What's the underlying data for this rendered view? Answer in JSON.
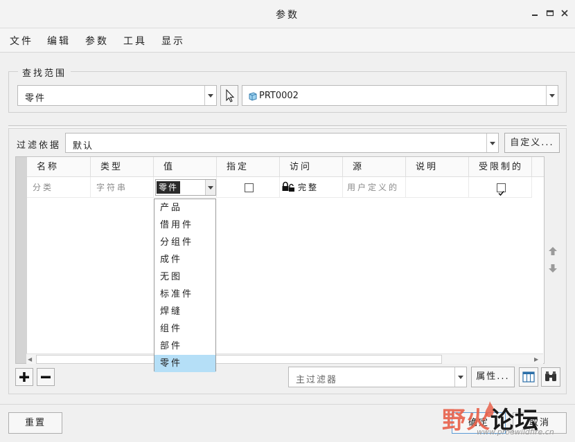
{
  "window": {
    "title": "参数"
  },
  "menubar": {
    "items": [
      "文件",
      "编辑",
      "参数",
      "工具",
      "显示"
    ]
  },
  "scope": {
    "legend": "查找范围",
    "type_value": "零件",
    "model_value": "PRT0002"
  },
  "filter": {
    "label": "过滤依据",
    "value": "默认",
    "customize_label": "自定义..."
  },
  "table": {
    "columns": [
      "名称",
      "类型",
      "值",
      "指定",
      "访问",
      "源",
      "说明",
      "受限制的"
    ],
    "rows": [
      {
        "name": "分类",
        "type": "字符串",
        "value": "零件",
        "designated": false,
        "access": "完整",
        "source": "用户定义的",
        "description": "",
        "restricted": true
      }
    ]
  },
  "value_dropdown": {
    "options": [
      "产品",
      "借用件",
      "分组件",
      "成件",
      "无图",
      "标准件",
      "焊缝",
      "组件",
      "部件",
      "零件"
    ],
    "selected": "零件"
  },
  "bottom_toolbar": {
    "main_filter_placeholder": "主过滤器",
    "properties_label": "属性..."
  },
  "footer": {
    "reset_label": "重置",
    "ok_label": "确定",
    "cancel_label": "取消"
  },
  "watermark": {
    "brand": "野火论坛",
    "url": "www.proewildfire.cn"
  },
  "colors": {
    "selection": "#b5dff7",
    "value_cell_bg": "#2b2b2b"
  }
}
